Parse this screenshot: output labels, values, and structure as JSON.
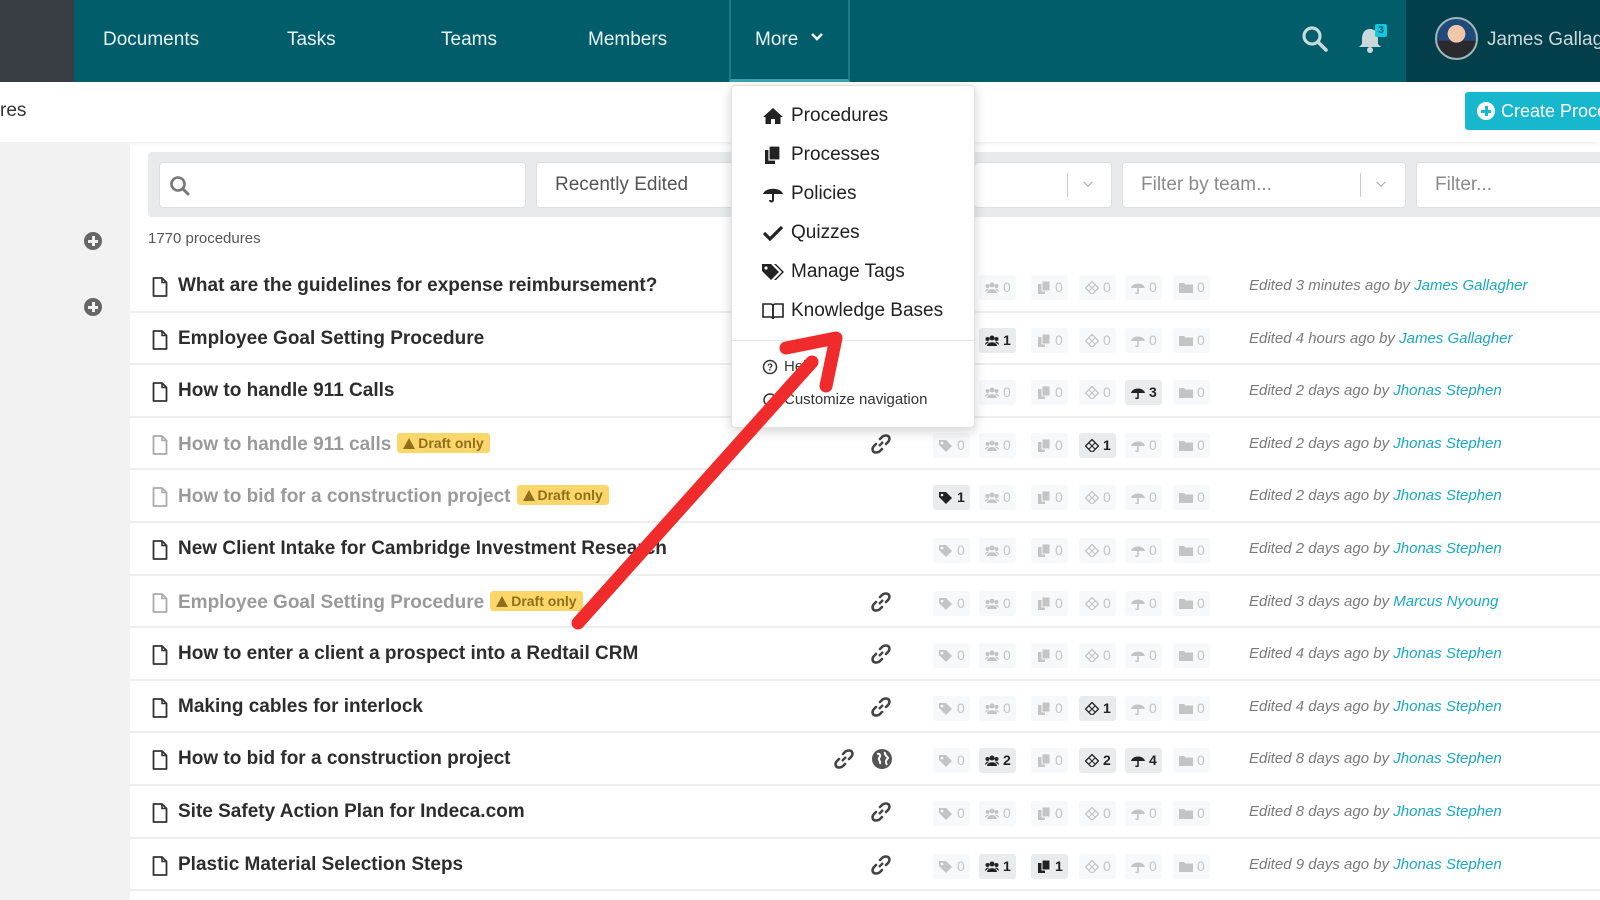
{
  "nav": {
    "items": [
      "Documents",
      "Tasks",
      "Teams",
      "Members"
    ],
    "more_label": "More",
    "notifications_count": "3",
    "user_name": "James Gallagher",
    "icons": {
      "search": "search-icon",
      "bell": "bell-icon",
      "chevron": "chevron-down-icon"
    }
  },
  "subheader": {
    "title_visible": "res",
    "create_button": "Create Procedure"
  },
  "filters": {
    "search_placeholder": "",
    "sort_value": "Recently Edited",
    "team_placeholder": "Filter by team...",
    "filter_placeholder": "Filter..."
  },
  "count_text": "1770 procedures",
  "more_menu": {
    "items": [
      {
        "label": "Procedures",
        "icon": "home-icon"
      },
      {
        "label": "Processes",
        "icon": "copy-icon"
      },
      {
        "label": "Policies",
        "icon": "umbrella-icon"
      },
      {
        "label": "Quizzes",
        "icon": "check-icon"
      },
      {
        "label": "Manage Tags",
        "icon": "tags-icon"
      },
      {
        "label": "Knowledge Bases",
        "icon": "book-open-icon"
      }
    ],
    "help_label": "Help",
    "customize_label": "Customize navigation"
  },
  "annotation": {
    "arrow_color": "#ef2b2b",
    "meaning": "pointing to Knowledge Bases"
  },
  "colors": {
    "topbar": "#025d6a",
    "accent": "#17b8cd",
    "link": "#19a9c2",
    "draft_badge": "#fbd76b"
  },
  "procedures": [
    {
      "title": "What are the guidelines for expense reimbursement?",
      "draft": false,
      "link": false,
      "globe": false,
      "tags": null,
      "members": 0,
      "processes": 0,
      "quizzes": 0,
      "policies": 0,
      "folders": 0,
      "edited": "Edited 3 minutes ago by",
      "editor": "James Gallagher"
    },
    {
      "title": "Employee Goal Setting Procedure",
      "draft": false,
      "link": false,
      "globe": false,
      "tags": null,
      "members": 1,
      "processes": 0,
      "quizzes": 0,
      "policies": 0,
      "folders": 0,
      "edited": "Edited 4 hours ago by",
      "editor": "James Gallagher"
    },
    {
      "title": "How to handle 911 Calls",
      "draft": false,
      "link": false,
      "globe": false,
      "tags": null,
      "members": 0,
      "processes": 0,
      "quizzes": 0,
      "policies": 3,
      "folders": 0,
      "edited": "Edited 2 days ago by",
      "editor": "Jhonas Stephen"
    },
    {
      "title": "How to handle 911 calls",
      "draft": true,
      "link": true,
      "globe": false,
      "tags": 0,
      "members": 0,
      "processes": 0,
      "quizzes": 1,
      "policies": 0,
      "folders": 0,
      "edited": "Edited 2 days ago by",
      "editor": "Jhonas Stephen"
    },
    {
      "title": "How to bid for a construction project",
      "draft": true,
      "link": false,
      "globe": false,
      "tags": 1,
      "members": 0,
      "processes": 0,
      "quizzes": 0,
      "policies": 0,
      "folders": 0,
      "edited": "Edited 2 days ago by",
      "editor": "Jhonas Stephen"
    },
    {
      "title": "New Client Intake for Cambridge Investment Research",
      "draft": false,
      "link": false,
      "globe": false,
      "tags": 0,
      "members": 0,
      "processes": 0,
      "quizzes": 0,
      "policies": 0,
      "folders": 0,
      "edited": "Edited 2 days ago by",
      "editor": "Jhonas Stephen"
    },
    {
      "title": "Employee Goal Setting Procedure",
      "draft": true,
      "link": true,
      "globe": false,
      "tags": 0,
      "members": 0,
      "processes": 0,
      "quizzes": 0,
      "policies": 0,
      "folders": 0,
      "edited": "Edited 3 days ago by",
      "editor": "Marcus Nyoung"
    },
    {
      "title": "How to enter a client a prospect into a Redtail CRM",
      "draft": false,
      "link": true,
      "globe": false,
      "tags": 0,
      "members": 0,
      "processes": 0,
      "quizzes": 0,
      "policies": 0,
      "folders": 0,
      "edited": "Edited 4 days ago by",
      "editor": "Jhonas Stephen"
    },
    {
      "title": "Making cables for interlock",
      "draft": false,
      "link": true,
      "globe": false,
      "tags": 0,
      "members": 0,
      "processes": 0,
      "quizzes": 1,
      "policies": 0,
      "folders": 0,
      "edited": "Edited 4 days ago by",
      "editor": "Jhonas Stephen"
    },
    {
      "title": "How to bid for a construction project",
      "draft": false,
      "link": true,
      "globe": true,
      "tags": 0,
      "members": 2,
      "processes": 0,
      "quizzes": 2,
      "policies": 4,
      "folders": 0,
      "edited": "Edited 8 days ago by",
      "editor": "Jhonas Stephen"
    },
    {
      "title": "Site Safety Action Plan for Indeca.com",
      "draft": false,
      "link": true,
      "globe": false,
      "tags": 0,
      "members": 0,
      "processes": 0,
      "quizzes": 0,
      "policies": 0,
      "folders": 0,
      "edited": "Edited 8 days ago by",
      "editor": "Jhonas Stephen"
    },
    {
      "title": "Plastic Material Selection Steps",
      "draft": false,
      "link": true,
      "globe": false,
      "tags": 0,
      "members": 1,
      "processes": 1,
      "quizzes": 0,
      "policies": 0,
      "folders": 0,
      "edited": "Edited 9 days ago by",
      "editor": "Jhonas Stephen"
    }
  ],
  "draft_label": "Draft only"
}
